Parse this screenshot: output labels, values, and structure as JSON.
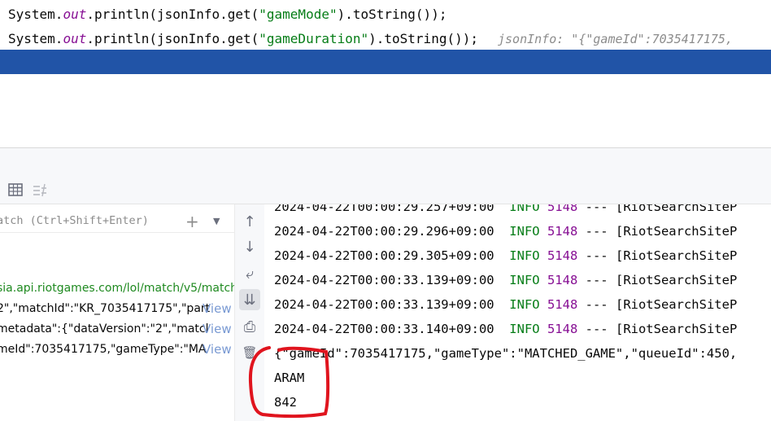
{
  "editor": {
    "line1": {
      "prefix": "System.",
      "out": "out",
      "mid": ".println(jsonInfo.get(",
      "key": "\"gameMode\"",
      "suffix": ").toString());"
    },
    "line2": {
      "prefix": "System.",
      "out": "out",
      "mid": ".println(jsonInfo.get(",
      "key": "\"gameDuration\"",
      "suffix": ").toString());",
      "inlay": "jsonInfo: \"{\"gameId\":7035417175,"
    }
  },
  "toolbar": {
    "table_icon": "table-icon",
    "compare_icon": "compare-icon"
  },
  "variables": {
    "watch_placeholder": "atch (Ctrl+Shift+Enter)",
    "add_watch_glyph": "+",
    "dropdown_glyph": "▼",
    "url_fragment": "sia.api.riotgames.com/lol/match/v5/matche",
    "row1": "2\",\"matchId\":\"KR_7035417175\",\"part",
    "row2": "metadata\":{\"dataVersion\":\"2\",\"matcl",
    "row3": "meId\":7035417175,\"gameType\":\"MA",
    "view_label": "View"
  },
  "gutter": {
    "buttons": [
      {
        "name": "scroll-up-icon",
        "glyph": "↑"
      },
      {
        "name": "scroll-down-icon",
        "glyph": "↓"
      },
      {
        "name": "soft-wrap-icon",
        "glyph": "⤶"
      },
      {
        "name": "scroll-to-end-icon",
        "glyph": "⇊"
      },
      {
        "name": "print-icon",
        "glyph": "⎙"
      },
      {
        "name": "trash-icon",
        "glyph": "🗑"
      }
    ]
  },
  "console": {
    "logs": [
      {
        "time": "2024-04-22T00:00:29.257+09:00",
        "level": "INFO",
        "pid": "5148",
        "sep": "---",
        "thread": "[RiotSearchSiteP"
      },
      {
        "time": "2024-04-22T00:00:29.296+09:00",
        "level": "INFO",
        "pid": "5148",
        "sep": "---",
        "thread": "[RiotSearchSiteP"
      },
      {
        "time": "2024-04-22T00:00:29.305+09:00",
        "level": "INFO",
        "pid": "5148",
        "sep": "---",
        "thread": "[RiotSearchSiteP"
      },
      {
        "time": "2024-04-22T00:00:33.139+09:00",
        "level": "INFO",
        "pid": "5148",
        "sep": "---",
        "thread": "[RiotSearchSiteP"
      },
      {
        "time": "2024-04-22T00:00:33.139+09:00",
        "level": "INFO",
        "pid": "5148",
        "sep": "---",
        "thread": "[RiotSearchSiteP"
      },
      {
        "time": "2024-04-22T00:00:33.140+09:00",
        "level": "INFO",
        "pid": "5148",
        "sep": "---",
        "thread": "[RiotSearchSiteP"
      }
    ],
    "json_output": "{\"gameId\":7035417175,\"gameType\":\"MATCHED_GAME\",\"queueId\":450,",
    "game_mode": "ARAM",
    "game_duration": "842"
  },
  "colors": {
    "execution_line": "#2154a7",
    "annotation": "#e0141e"
  }
}
